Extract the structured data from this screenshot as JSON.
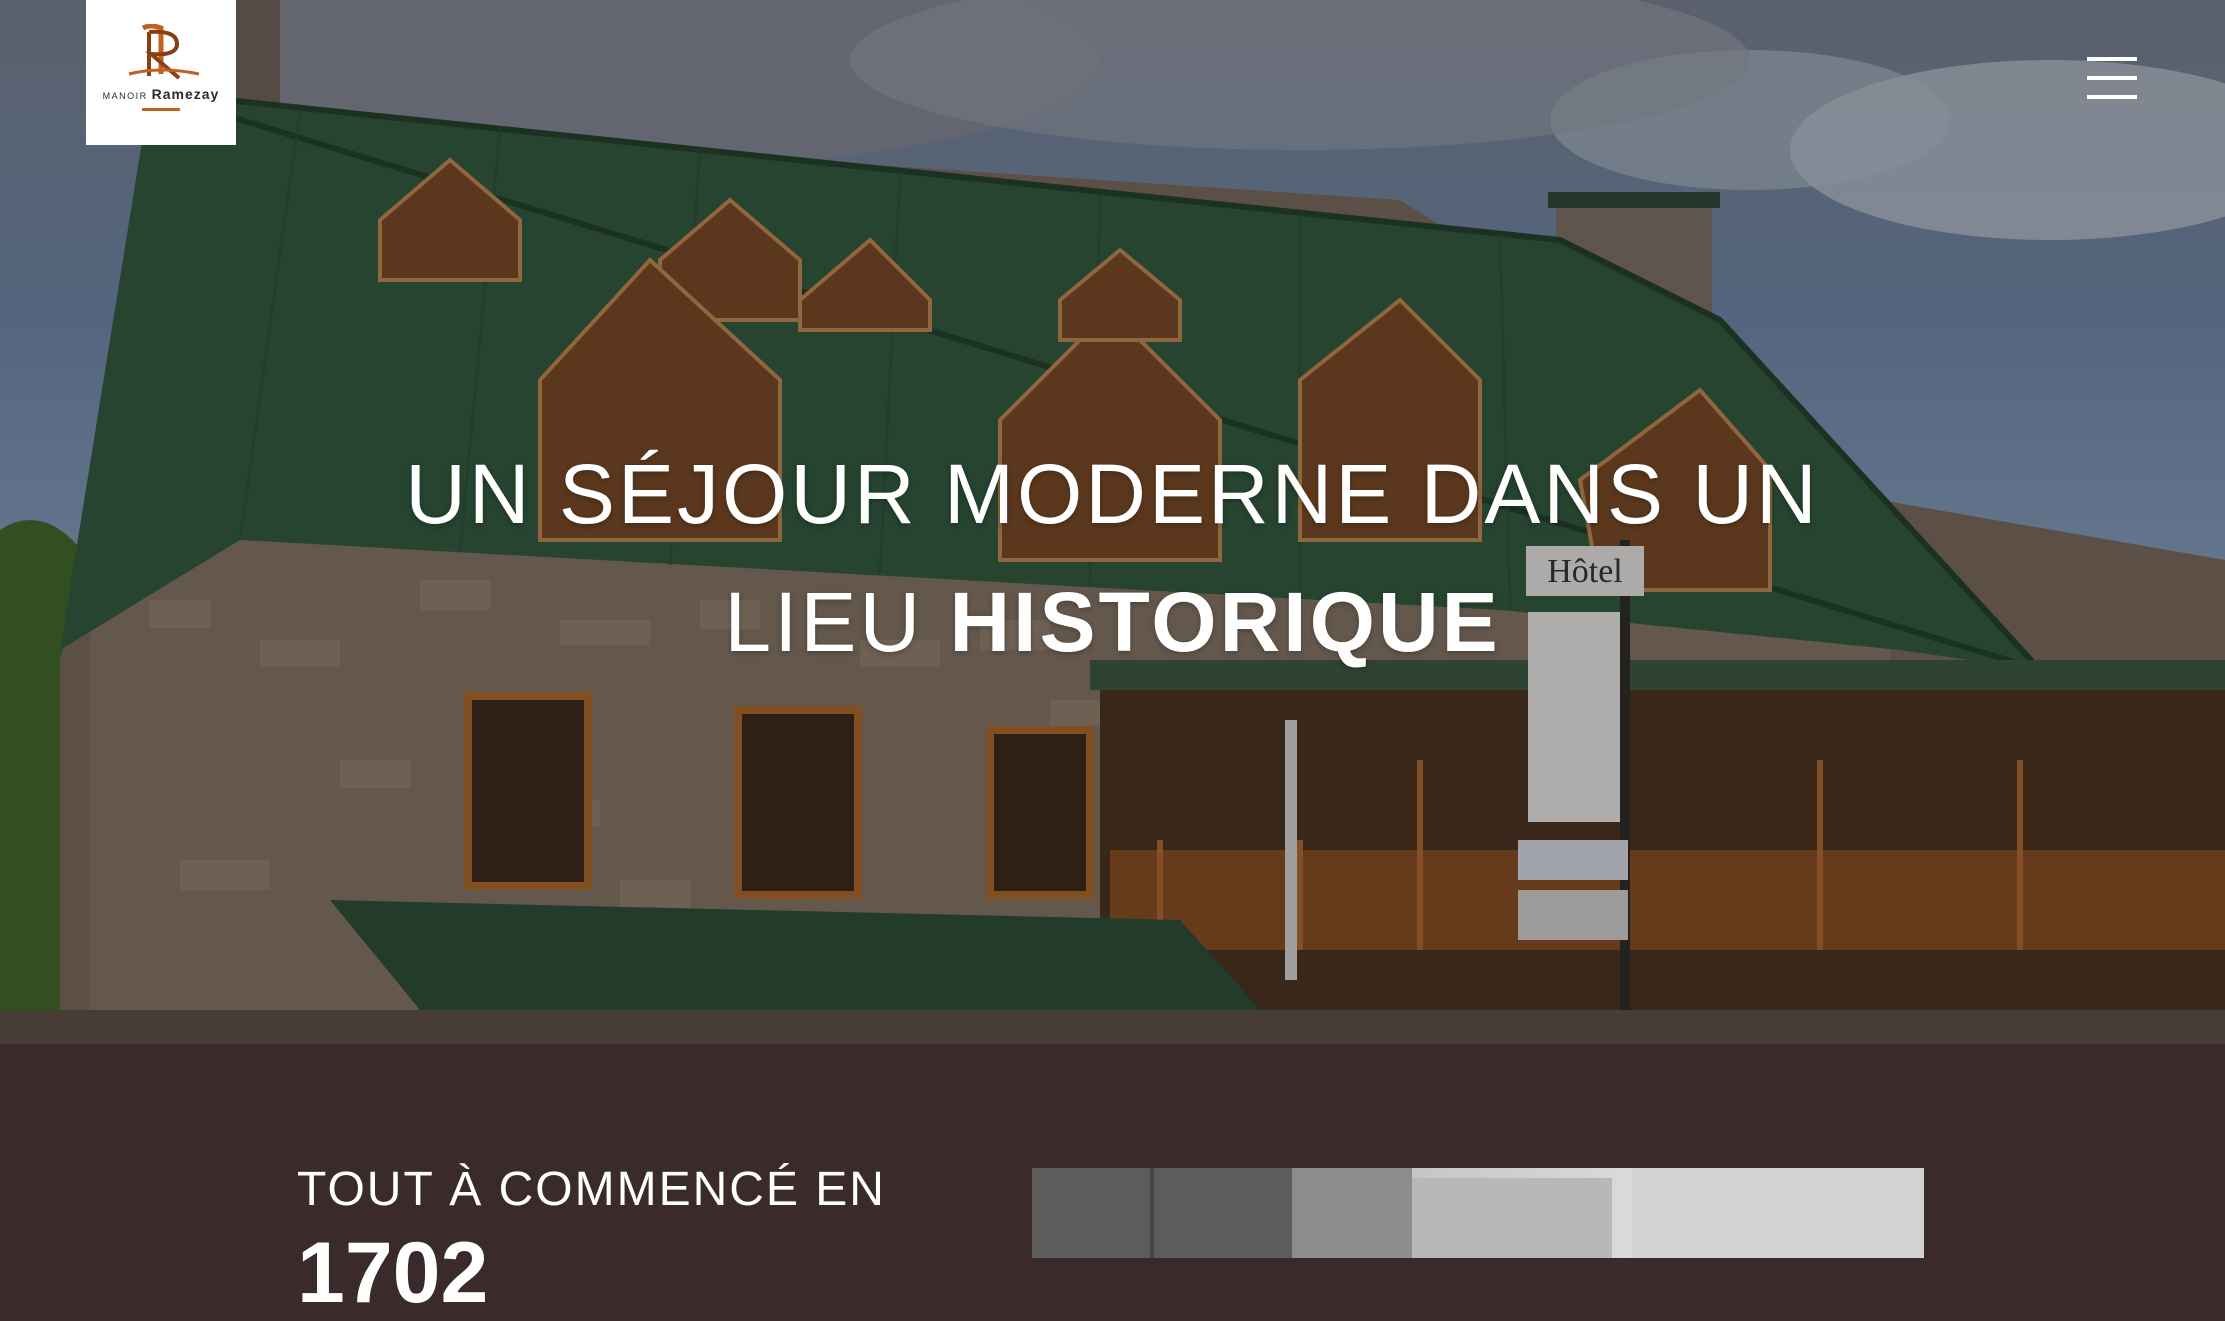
{
  "header": {
    "logo": {
      "small_text": "MANOIR",
      "big_text": "Ramezay",
      "accent_color": "#c0621f"
    },
    "menu_icon": "hamburger-icon"
  },
  "hero": {
    "headline_line1": "UN SÉJOUR MODERNE DANS UN",
    "headline_line2_prefix": "LIEU",
    "headline_line2_accent": "HISTORIQUE",
    "sign_text": "Hôtel",
    "accent_color": "#c0621f"
  },
  "about": {
    "heading": "TOUT À COMMENCÉ EN",
    "year": "1702"
  },
  "colors": {
    "section_background": "#3a2a2a",
    "roof_green": "#2f5b3f",
    "text": "#ffffff"
  }
}
